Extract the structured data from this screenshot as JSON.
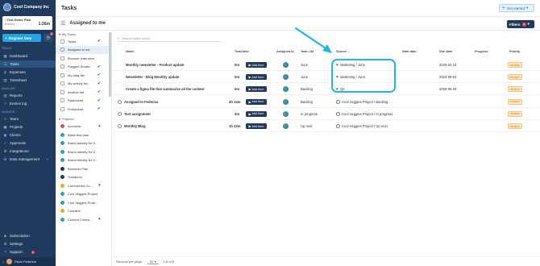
{
  "sidebar": {
    "company": "Cool Company Inc",
    "timer": {
      "title": "• Test Demo Plan",
      "subtitle": "Backlog",
      "time": "1:26m"
    },
    "register_label": "Register time",
    "register_badge": "1",
    "sections": {
      "track": "TRACK",
      "analyze": "ANALYZE",
      "manage": "MANAGE"
    },
    "track_items": [
      {
        "label": "Dashboard",
        "icon": "dashboard-icon"
      },
      {
        "label": "Tasks",
        "icon": "tasks-icon"
      },
      {
        "label": "Expenses",
        "icon": "expenses-icon"
      },
      {
        "label": "Timesheet",
        "icon": "timesheet-icon"
      }
    ],
    "analyze_items": [
      {
        "label": "Reports",
        "icon": "reports-icon"
      },
      {
        "label": "Entries log",
        "icon": "entries-log-icon"
      }
    ],
    "manage_items": [
      {
        "label": "Team",
        "icon": "team-icon"
      },
      {
        "label": "Projects",
        "icon": "projects-icon"
      },
      {
        "label": "Clients",
        "icon": "clients-icon"
      },
      {
        "label": "Approvals",
        "icon": "approvals-icon"
      },
      {
        "label": "Integrations",
        "icon": "integrations-icon"
      },
      {
        "label": "Data management",
        "icon": "data-management-icon"
      }
    ],
    "bottom_items": [
      {
        "label": "Subscription",
        "icon": "subscription-icon"
      },
      {
        "label": "Settings",
        "icon": "settings-icon"
      },
      {
        "label": "Support",
        "icon": "support-icon",
        "badge": "1"
      }
    ],
    "user": "Rossi Federica"
  },
  "header": {
    "title": "Tasks",
    "get_started": "Get started"
  },
  "subheader": {
    "title": "Assigned to me",
    "filters": "Filters",
    "filters_count": "1"
  },
  "lists": {
    "my_tasks_label": "My Tasks",
    "my_tasks": [
      {
        "label": "Tasks",
        "check": true
      },
      {
        "label": "Assigned to me",
        "check": false,
        "active": true
      },
      {
        "label": "Browser extension",
        "check": false
      },
      {
        "label": "Flagged Emails",
        "check": true
      },
      {
        "label": "My daily list",
        "check": true
      },
      {
        "label": "My weekly list",
        "check": true
      },
      {
        "label": "Another list",
        "check": true
      },
      {
        "label": "Radiohead",
        "check": true
      },
      {
        "label": "Portishead",
        "check": true
      }
    ],
    "projects_label": "Projects",
    "projects": [
      {
        "label": "Accounts",
        "color": "#e05050",
        "heart": true
      },
      {
        "label": "Basic test plan",
        "color": "#2aa6a8",
        "heart": false
      },
      {
        "label": "Brand identity for V...",
        "color": "#2aa6a8",
        "heart": false
      },
      {
        "label": "Brand identity for V...",
        "color": "#2aa6a8",
        "heart": false
      },
      {
        "label": "Brand identity for V...",
        "color": "#2aa6a8",
        "heart": false
      },
      {
        "label": "Business Plan",
        "color": "#1f3a5c",
        "heart": false
      },
      {
        "label": "Sussbood",
        "color": "#1f3a5c",
        "heart": false
      },
      {
        "label": "Commercial Co...",
        "color": "#e0b020",
        "heart": true
      },
      {
        "label": "Cool Veggies Project",
        "color": "#2aa6a8",
        "heart": false
      },
      {
        "label": "Cool Veggies Proje...",
        "color": "#2aa6a8",
        "heart": false
      },
      {
        "label": "Cuanlinh",
        "color": "#e0b020",
        "heart": false
      },
      {
        "label": "Custom Contra...",
        "color": "#2aa6a8",
        "heart": true
      }
    ]
  },
  "main": {
    "search_placeholder": "Search within tasks",
    "columns": [
      "Name",
      "Total time",
      "Assigned to",
      "Task List",
      "Source",
      "Start date",
      "Due date",
      "Progress",
      "Priority"
    ],
    "add_time_label": "Add time",
    "rows": [
      {
        "name": "Monthly newsletter - Product update",
        "time": "0m",
        "list": "June",
        "source": "Marketing / June",
        "source_type": "heart",
        "due": "2025-02-24",
        "priority": "Medium",
        "check": false
      },
      {
        "name": "Newsletter - Blog Monthly update",
        "time": "0m",
        "list": "June",
        "source": "Marketing / June",
        "source_type": "heart",
        "due": "2023-09-04",
        "priority": "Medium",
        "check": false
      },
      {
        "name": "Create a figma file that summarize all the content",
        "time": "0m",
        "list": "Backlog",
        "source": "Q2",
        "source_type": "heart",
        "due": "2025-05-28",
        "priority": "Medium",
        "check": false
      },
      {
        "name": "Assigned to Federica",
        "time": "4h 14m",
        "list": "Backlog",
        "source": "Cool Veggies Project / Backlog",
        "source_type": "ring",
        "due": "",
        "priority": "Medium",
        "check": true
      },
      {
        "name": "Test assignment",
        "time": "3m",
        "list": "In progress",
        "source": "Cool Veggies Project / In progress",
        "source_type": "ring",
        "due": "",
        "priority": "Medium",
        "check": true
      },
      {
        "name": "Monthly Blog",
        "time": "1h 43m",
        "list": "Up next",
        "source": "Cool Veggies Project / Up next",
        "source_type": "ring",
        "due": "",
        "priority": "Medium",
        "check": true
      }
    ]
  },
  "footer": {
    "records_label": "Records per page:",
    "records_value": "50",
    "range": "1-6 of 6"
  },
  "colors": {
    "sidebar": "#1f3a5c",
    "accent": "#29a3e0",
    "highlight": "#21b6e3",
    "priority": "#fbe7c7"
  }
}
